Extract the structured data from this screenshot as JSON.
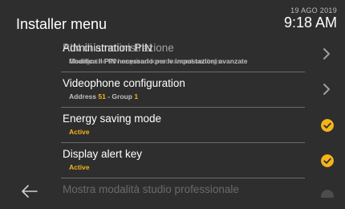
{
  "header": {
    "title": "Installer menu",
    "date": "19 AGO 2019",
    "time": "9:18 AM"
  },
  "menu": {
    "items": [
      {
        "label": "Administration PIN",
        "label_overlap": "PIN di amministrazione",
        "sub": "Modifica il PIN necessario per le impostazioni avanzate",
        "sub_overlap": "Change the PIN required for advanced settings",
        "icon": "chevron-right-icon"
      },
      {
        "label": "Videophone configuration",
        "sub_address_label": "Address",
        "sub_address_value": "51",
        "sub_sep": "- Group",
        "sub_group_value": "1",
        "icon": "chevron-right-icon"
      },
      {
        "label": "Energy saving mode",
        "sub": "Active",
        "icon": "check-circle-icon"
      },
      {
        "label": "Display alert key",
        "sub": "Active",
        "icon": "check-circle-icon"
      },
      {
        "label": "Mostra modalità studio professionale",
        "icon": "check-circle-icon"
      }
    ]
  },
  "colors": {
    "background": "#2e2e2e",
    "accent": "#f4b41a",
    "divider": "#6b6b6b"
  },
  "footer": {
    "back_icon": "arrow-left-icon"
  }
}
